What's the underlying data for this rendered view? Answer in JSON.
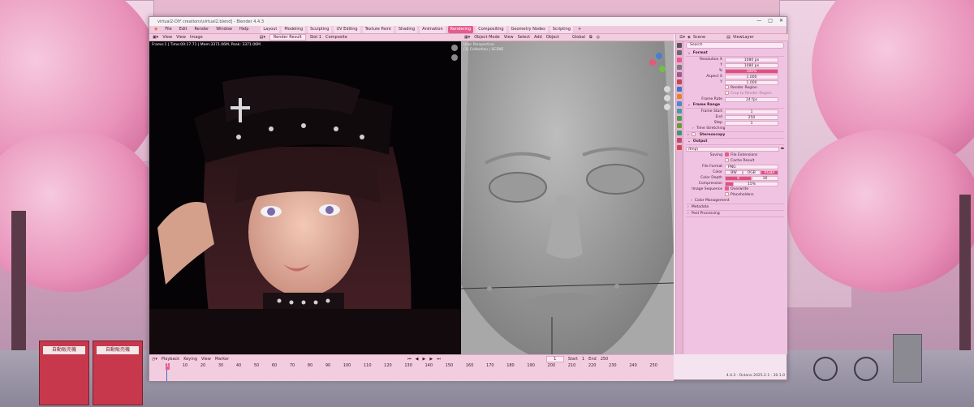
{
  "window": {
    "title": "virtual2-DIY creations\\virtual2.blend] - Blender 4.4.3",
    "controls": [
      "—",
      "□",
      "✕"
    ]
  },
  "menu": {
    "items": [
      "File",
      "Edit",
      "Render",
      "Window",
      "Help"
    ],
    "workspaces": [
      "Layout",
      "Modeling",
      "Sculpting",
      "UV Editing",
      "Texture Paint",
      "Shading",
      "Animation",
      "Rendering",
      "Compositing",
      "Geometry Nodes",
      "Scripting"
    ],
    "active_workspace": "Rendering",
    "add_tab": "+"
  },
  "image_editor": {
    "header": [
      "View",
      "View",
      "Image"
    ],
    "render_result": "Render Result",
    "slot": "Slot 1",
    "layer": "Composite",
    "info": "Frame:1 | Time:00:17.71 | Mem:3371.06M, Peak: 3371.06M"
  },
  "viewport": {
    "mode": "Object Mode",
    "menus": [
      "View",
      "Select",
      "Add",
      "Object"
    ],
    "transform": "Global",
    "label_line1": "User Perspective",
    "label_line2": "(1) Collection | SCENE"
  },
  "properties": {
    "scene": "Scene",
    "view_layer": "ViewLayer",
    "search_placeholder": "Search",
    "format": {
      "title": "Format",
      "res_x_label": "Resolution X",
      "res_x": "1080 px",
      "res_y_label": "Y",
      "res_y": "1080 px",
      "pct_label": "%",
      "pct": "100%",
      "aspect_x_label": "Aspect X",
      "aspect_x": "1.000",
      "aspect_y_label": "Y",
      "aspect_y": "1.000",
      "render_region": "Render Region",
      "crop": "Crop to Render Region",
      "frame_rate_label": "Frame Rate",
      "frame_rate": "24 fps"
    },
    "frame_range": {
      "title": "Frame Range",
      "start_label": "Frame Start",
      "start": "1",
      "end_label": "End",
      "end": "250",
      "step_label": "Step",
      "step": "1"
    },
    "time_stretching": "Time Stretching",
    "stereoscopy": "Stereoscopy",
    "output": {
      "title": "Output",
      "path": "/tmp\\",
      "saving_label": "Saving",
      "file_ext": "File Extensions",
      "cache": "Cache Result",
      "file_format_label": "File Format",
      "file_format": "PNG",
      "color_label": "Color",
      "color_opts": [
        "BW",
        "RGB",
        "RGBA"
      ],
      "color_active": "RGBA",
      "depth_label": "Color Depth",
      "depth_opts": [
        "8",
        "16"
      ],
      "compression_label": "Compression",
      "compression": "15%",
      "seq_label": "Image Sequence",
      "overwrite": "Overwrite",
      "placeholders": "Placeholders"
    },
    "color_management": "Color Management",
    "metadata": "Metadata",
    "post_processing": "Post Processing"
  },
  "timeline": {
    "menus": [
      "Playback",
      "Keying",
      "View",
      "Marker"
    ],
    "current": "1",
    "start_label": "Start",
    "start": "1",
    "end_label": "End",
    "end": "250",
    "ticks": [
      "1",
      "10",
      "20",
      "30",
      "40",
      "50",
      "60",
      "70",
      "80",
      "90",
      "100",
      "110",
      "120",
      "130",
      "140",
      "150",
      "160",
      "170",
      "180",
      "190",
      "200",
      "210",
      "220",
      "230",
      "240",
      "250"
    ]
  },
  "status": "4.4.3 · Octane 2025.2.1 - 30.1.0",
  "desktop": {
    "vending_sign": "自動販売機"
  },
  "colors": {
    "accent": "#e75b8d",
    "panel": "#f1c3e3"
  }
}
